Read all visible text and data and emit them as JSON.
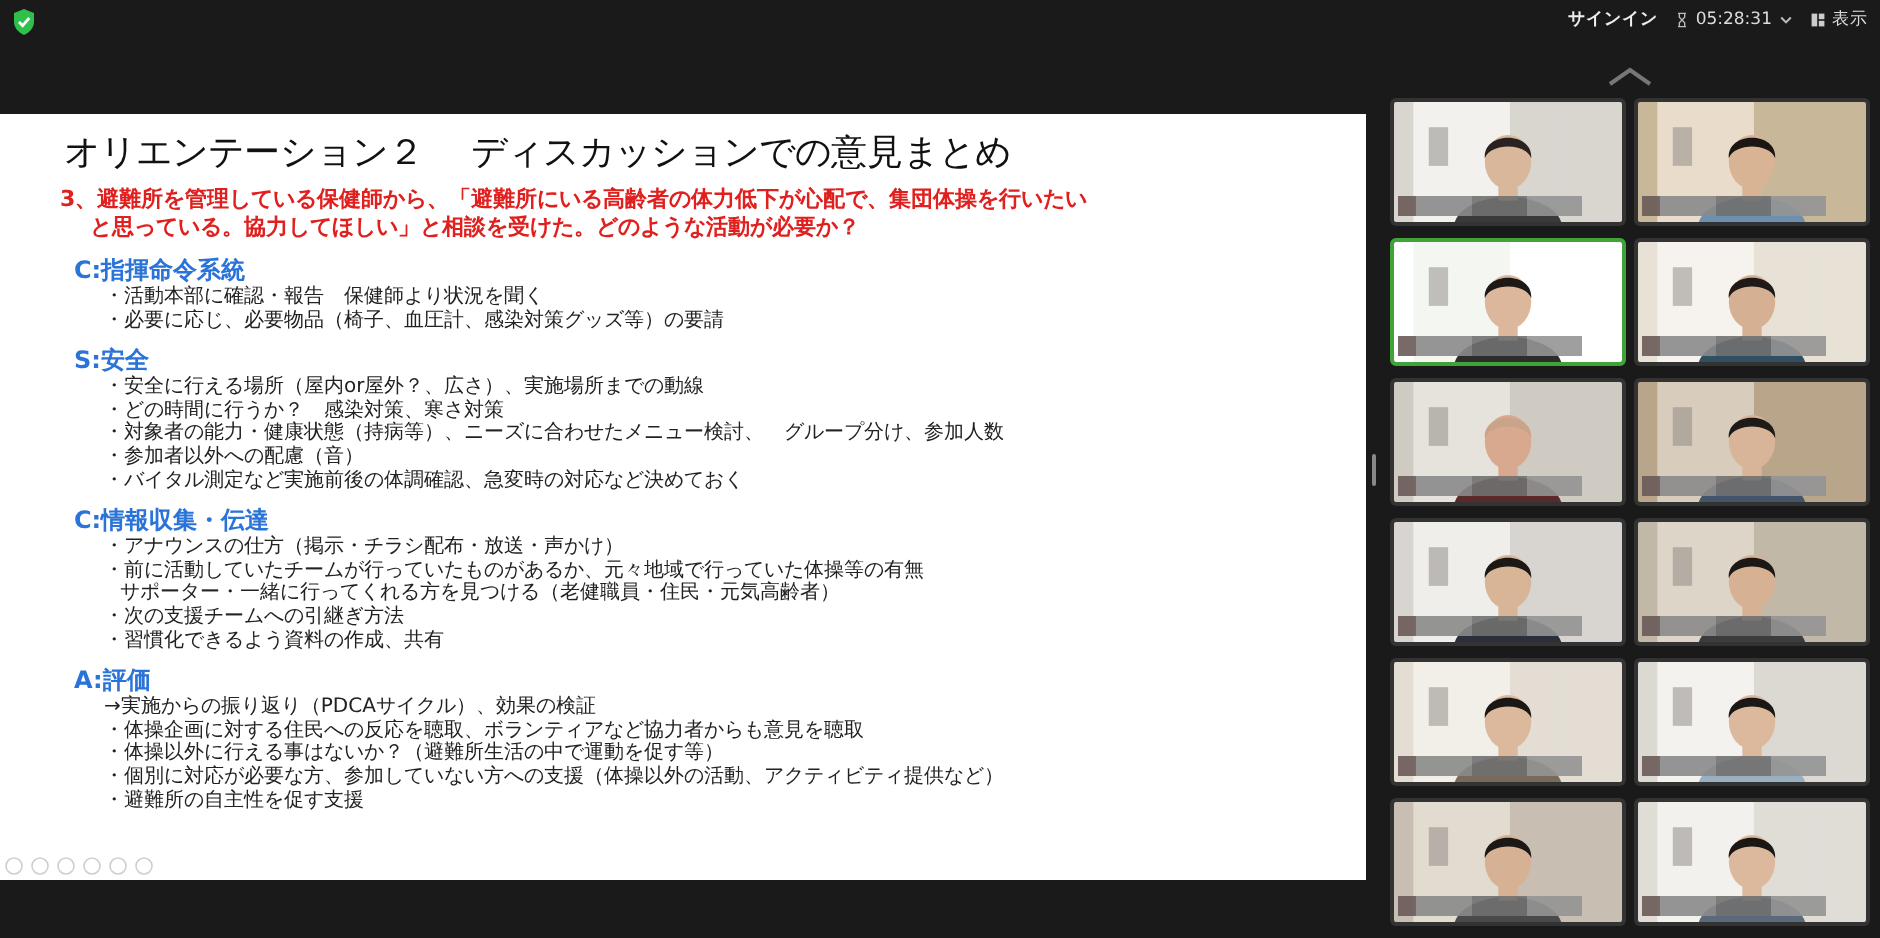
{
  "top_bar": {
    "sign_in": "サインイン",
    "timer": "05:28:31",
    "view": "表示"
  },
  "slide": {
    "title": "オリエンテーション２　 ディスカッションでの意見まとめ",
    "question_lines": [
      "3、避難所を管理している保健師から、「避難所にいる高齢者の体力低下が心配で、集団体操を行いたい",
      "と思っている。協力してほしい」と相談を受けた。どのような活動が必要か？"
    ],
    "sections": [
      {
        "heading": "C:指揮命令系統",
        "items": [
          {
            "kind": "bullet",
            "text": "・活動本部に確認・報告　保健師より状況を聞く"
          },
          {
            "kind": "bullet",
            "text": "・必要に応じ、必要物品（椅子、血圧計、感染対策グッズ等）の要請"
          }
        ]
      },
      {
        "heading": "S:安全",
        "items": [
          {
            "kind": "bullet",
            "text": "・安全に行える場所（屋内or屋外？、広さ）、実施場所までの動線"
          },
          {
            "kind": "bullet",
            "text": "・どの時間に行うか？　感染対策、寒さ対策"
          },
          {
            "kind": "bullet",
            "text": "・対象者の能力・健康状態（持病等）、ニーズに合わせたメニュー検討、　グループ分け、参加人数"
          },
          {
            "kind": "bullet",
            "text": "・参加者以外への配慮（音）"
          },
          {
            "kind": "bullet",
            "text": "・バイタル測定など実施前後の体調確認、急変時の対応など決めておく"
          }
        ]
      },
      {
        "heading": "C:情報収集・伝達",
        "items": [
          {
            "kind": "bullet",
            "text": "・アナウンスの仕方（掲示・チラシ配布・放送・声かけ）"
          },
          {
            "kind": "bullet",
            "text": "・前に活動していたチームが行っていたものがあるか、元々地域で行っていた体操等の有無"
          },
          {
            "kind": "continuation",
            "text": "サポーター・一緒に行ってくれる方を見つける（老健職員・住民・元気高齢者）"
          },
          {
            "kind": "bullet",
            "text": "・次の支援チームへの引継ぎ方法"
          },
          {
            "kind": "bullet",
            "text": "・習慣化できるよう資料の作成、共有"
          }
        ]
      },
      {
        "heading": "A:評価",
        "items": [
          {
            "kind": "arrow",
            "text": "→実施からの振り返り（PDCAサイクル）、効果の検証"
          },
          {
            "kind": "bullet",
            "text": "・体操企画に対する住民への反応を聴取、ボランティアなど協力者からも意見を聴取"
          },
          {
            "kind": "bullet",
            "text": "・体操以外に行える事はないか？（避難所生活の中で運動を促す等）"
          },
          {
            "kind": "bullet",
            "text": "・個別に対応が必要な方、参加していない方への支援（体操以外の活動、アクティビティ提供など）"
          },
          {
            "kind": "bullet",
            "text": "・避難所の自主性を促す支援"
          }
        ]
      }
    ]
  },
  "participants": [
    {
      "kind": "picture",
      "speaking": false
    },
    {
      "kind": "picture",
      "speaking": false
    },
    {
      "kind": "picture",
      "speaking": true
    },
    {
      "kind": "picture",
      "speaking": false
    },
    {
      "kind": "picture",
      "speaking": false
    },
    {
      "kind": "picture",
      "speaking": false
    },
    {
      "kind": "picture",
      "speaking": false
    },
    {
      "kind": "picture",
      "speaking": false
    },
    {
      "kind": "picture",
      "speaking": false
    },
    {
      "kind": "picture",
      "speaking": false
    },
    {
      "kind": "picture",
      "speaking": false
    },
    {
      "kind": "picture",
      "speaking": false
    }
  ]
}
